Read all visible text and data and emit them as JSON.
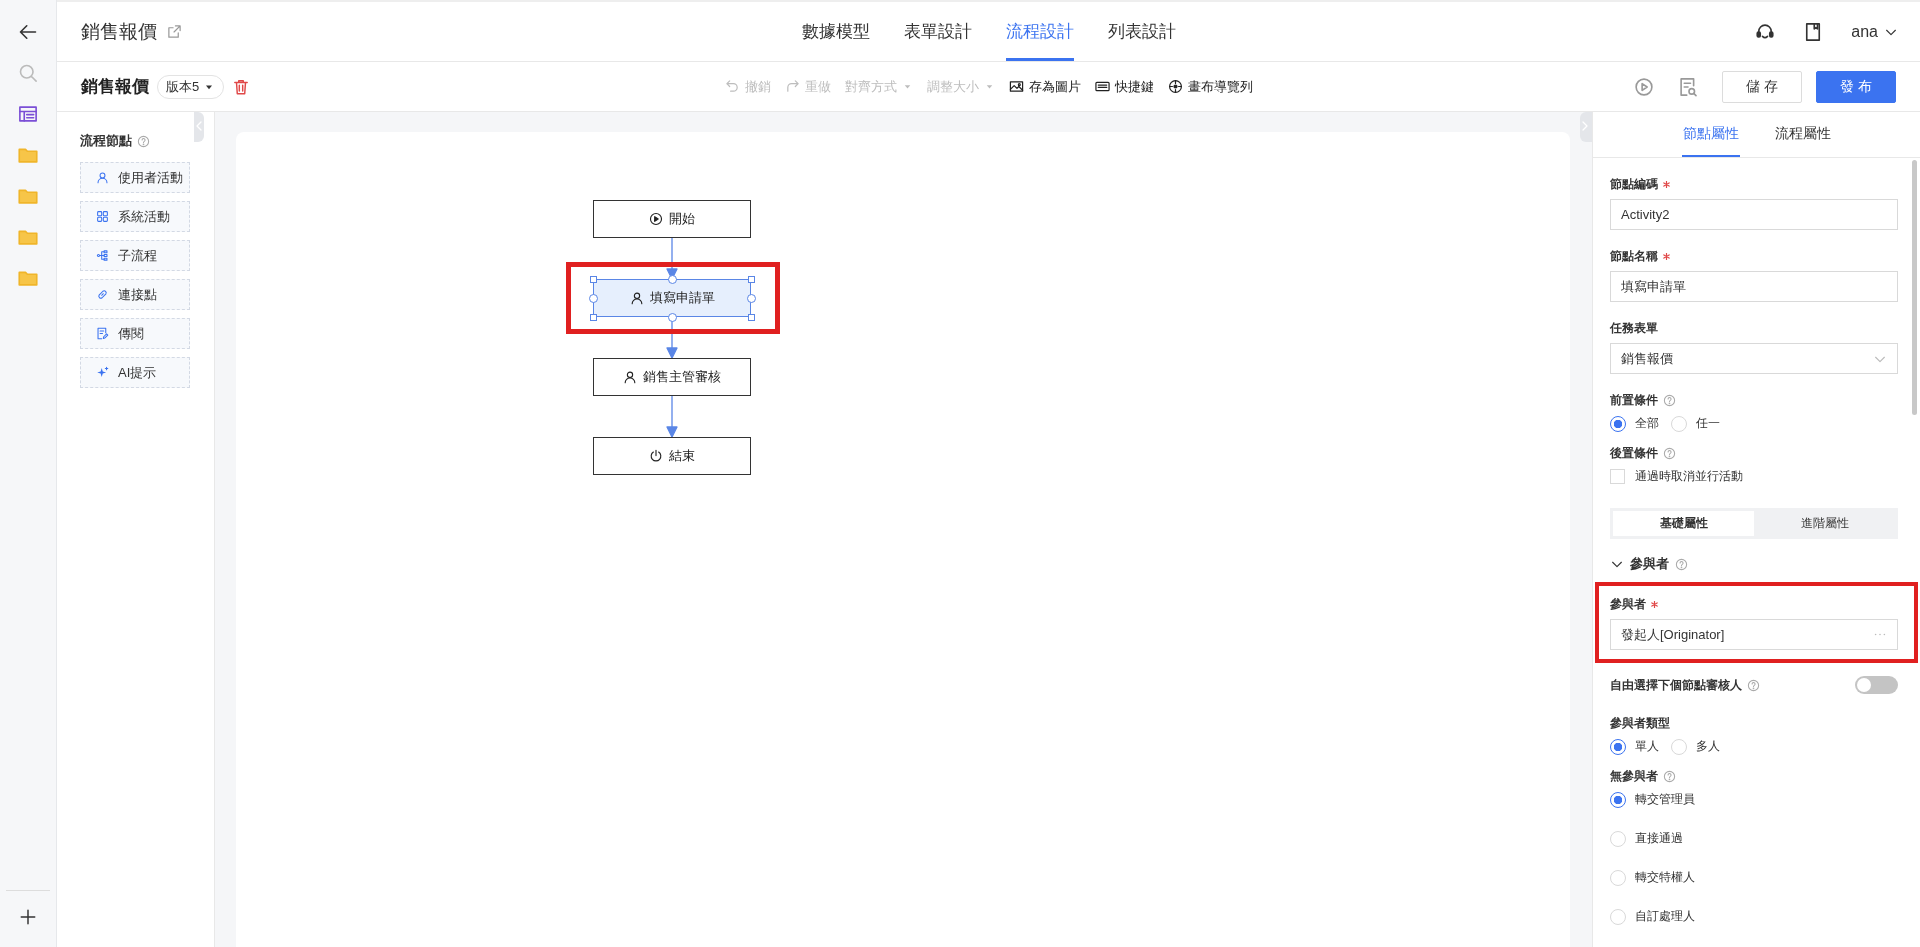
{
  "header": {
    "title": "銷售報價",
    "user": "ana"
  },
  "nav_tabs": [
    {
      "label": "數據模型",
      "selected": false
    },
    {
      "label": "表單設計",
      "selected": false
    },
    {
      "label": "流程設計",
      "selected": true
    },
    {
      "label": "列表設計",
      "selected": false
    }
  ],
  "toolbar": {
    "form_title": "銷售報價",
    "version": "版本5",
    "actions": [
      {
        "label": "撤銷",
        "disabled": true,
        "dropdown": false
      },
      {
        "label": "重做",
        "disabled": true,
        "dropdown": false
      },
      {
        "label": "對齊方式",
        "disabled": true,
        "dropdown": true
      },
      {
        "label": "調整大小",
        "disabled": true,
        "dropdown": true
      },
      {
        "label": "存為圖片",
        "disabled": false,
        "dropdown": false
      },
      {
        "label": "快捷鍵",
        "disabled": false,
        "dropdown": false
      },
      {
        "label": "畫布導覽列",
        "disabled": false,
        "dropdown": false
      }
    ],
    "save": "儲 存",
    "publish": "發 布"
  },
  "node_palette": {
    "title": "流程節點",
    "items": [
      {
        "label": "使用者活動"
      },
      {
        "label": "系統活動"
      },
      {
        "label": "子流程"
      },
      {
        "label": "連接點"
      },
      {
        "label": "傳閱"
      },
      {
        "label": "AI提示"
      }
    ]
  },
  "canvas": {
    "nodes": [
      {
        "kind": "start",
        "label": "開始",
        "selected": false
      },
      {
        "kind": "activity",
        "label": "填寫申請單",
        "selected": true,
        "highlighted": true
      },
      {
        "kind": "activity",
        "label": "銷售主管審核",
        "selected": false
      },
      {
        "kind": "end",
        "label": "結束",
        "selected": false
      }
    ]
  },
  "properties": {
    "tabs": [
      {
        "label": "節點屬性",
        "selected": true
      },
      {
        "label": "流程屬性",
        "selected": false
      }
    ],
    "fields": [
      {
        "kind": "text",
        "label": "節點編碼",
        "required": true,
        "value": "Activity2"
      },
      {
        "kind": "text",
        "label": "節點名稱",
        "required": true,
        "value": "填寫申請單"
      },
      {
        "kind": "select",
        "label": "任務表單",
        "value": "銷售報價"
      },
      {
        "kind": "radio_row",
        "label": "前置條件",
        "help": true,
        "options": [
          {
            "label": "全部",
            "selected": true
          },
          {
            "label": "任一",
            "selected": false
          }
        ]
      },
      {
        "kind": "checkbox",
        "label": "後置條件",
        "help": true,
        "option": {
          "label": "通過時取消並行活動",
          "checked": false
        }
      },
      {
        "kind": "segmented",
        "options": [
          {
            "label": "基礎屬性",
            "selected": true
          },
          {
            "label": "進階屬性",
            "selected": false
          }
        ]
      },
      {
        "kind": "section",
        "label": "參與者",
        "help": true,
        "expanded": true
      },
      {
        "kind": "picker",
        "label": "參與者",
        "required": true,
        "value": "發起人[Originator]",
        "highlighted": true
      },
      {
        "kind": "toggle",
        "label": "自由選擇下個節點審核人",
        "help": true,
        "on": false
      },
      {
        "kind": "radio_row",
        "label": "參與者類型",
        "options": [
          {
            "label": "單人",
            "selected": true
          },
          {
            "label": "多人",
            "selected": false
          }
        ]
      },
      {
        "kind": "radio_list",
        "label": "無參與者",
        "help": true,
        "options": [
          {
            "label": "轉交管理員",
            "selected": true
          },
          {
            "label": "直接通過",
            "selected": false
          },
          {
            "label": "轉交特權人",
            "selected": false
          },
          {
            "label": "自訂處理人",
            "selected": false
          }
        ]
      }
    ]
  }
}
